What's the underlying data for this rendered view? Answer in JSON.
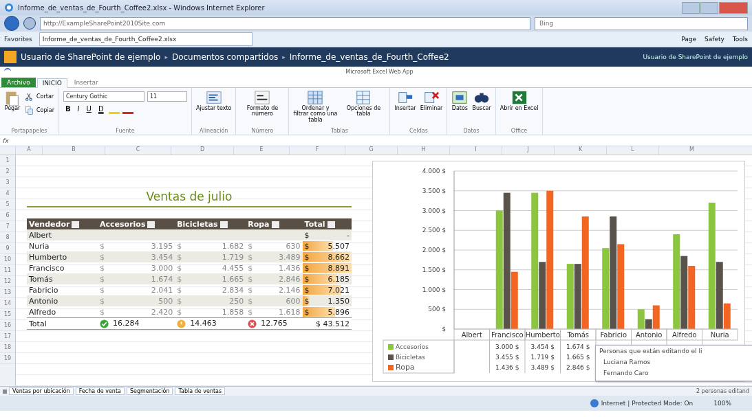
{
  "browser": {
    "title": "Informe_de_ventas_de_Fourth_Coffee2.xlsx - Windows Internet Explorer",
    "address": "http://ExampleSharePoint2010Site.com",
    "search_placeholder": "Bing",
    "favorites": "Favorites",
    "tab": "Informe_de_ventas_de_Fourth_Coffee2.xlsx",
    "commands": [
      "Page",
      "Safety",
      "Tools"
    ]
  },
  "sharepoint": {
    "separator": "▸",
    "breadcrumb": [
      "Usuario de SharePoint de ejemplo",
      "Documentos compartidos",
      "Informe_de_ventas_de_Fourth_Coffee2"
    ],
    "user": "Usuario de SharePoint de ejemplo"
  },
  "app_title": "Microsoft Excel Web App",
  "formula_label": "fx",
  "tabs": [
    {
      "label": "Archivo",
      "kind": "file",
      "selected": false
    },
    {
      "label": "INICIO",
      "kind": "tab",
      "selected": true
    },
    {
      "label": "Insertar",
      "kind": "tab",
      "selected": false
    }
  ],
  "ribbon": [
    {
      "label": "Portapapeles",
      "items": [
        {
          "kind": "paste",
          "label": "Pegar"
        },
        {
          "kind": "cut",
          "label": "Cortar"
        },
        {
          "kind": "copy",
          "label": "Copiar"
        }
      ]
    },
    {
      "label": "Fuente",
      "font": "Century Gothic",
      "size": "11",
      "format_buttons": [
        "B",
        "I",
        "U",
        "D"
      ]
    },
    {
      "label": "Alineación",
      "items": [
        {
          "kind": "wrap",
          "label": "Ajustar texto"
        }
      ]
    },
    {
      "label": "Número",
      "items": [
        {
          "kind": "number",
          "label": "Formato de número"
        }
      ]
    },
    {
      "label": "Tablas",
      "items": [
        {
          "kind": "table",
          "label": "Ordenar y filtrar como una tabla"
        },
        {
          "kind": "options",
          "label": "Opciones de tabla"
        }
      ]
    },
    {
      "label": "Celdas",
      "items": [
        {
          "kind": "insert",
          "label": "Insertar"
        },
        {
          "kind": "delete",
          "label": "Eliminar"
        }
      ]
    },
    {
      "label": "Datos",
      "items": [
        {
          "kind": "data",
          "label": "Datos"
        },
        {
          "kind": "find",
          "label": "Buscar"
        }
      ]
    },
    {
      "label": "Office",
      "items": [
        {
          "kind": "excel",
          "label": "Abrir en Excel"
        }
      ]
    }
  ],
  "columns": [
    "A",
    "B",
    "C",
    "D",
    "E",
    "F",
    "G",
    "H",
    "I",
    "J",
    "K",
    "L",
    "M"
  ],
  "row_numbers": [
    "1",
    "2",
    "3",
    "4",
    "5",
    "6",
    "7",
    "8",
    "9",
    "10",
    "11",
    "12",
    "13",
    "14",
    "15",
    "16",
    "17",
    "18",
    "19"
  ],
  "sheet_title": "Ventas de julio",
  "table": {
    "headers": [
      "Vendedor",
      "Accesorios",
      "Bicicletas",
      "Ropa",
      "Total"
    ],
    "rows": [
      {
        "name": "Albert",
        "cells": [],
        "total_cur": "$",
        "total": "-"
      },
      {
        "name": "Nuria",
        "cells": [
          {
            "cur": "$",
            "val": "3.195"
          },
          {
            "cur": "$",
            "val": "1.682"
          },
          {
            "cur": "$",
            "val": "630"
          }
        ],
        "total_cur": "$",
        "total": "5.507",
        "level": 0.62
      },
      {
        "name": "Humberto",
        "cells": [
          {
            "cur": "$",
            "val": "3.454"
          },
          {
            "cur": "$",
            "val": "1.719"
          },
          {
            "cur": "$",
            "val": "3.489"
          }
        ],
        "total_cur": "$",
        "total": "8.662",
        "level": 0.97
      },
      {
        "name": "Francisco",
        "cells": [
          {
            "cur": "$",
            "val": "3.000"
          },
          {
            "cur": "$",
            "val": "4.455"
          },
          {
            "cur": "$",
            "val": "1.436"
          }
        ],
        "total_cur": "$",
        "total": "8.891",
        "level": 1
      },
      {
        "name": "Tomás",
        "cells": [
          {
            "cur": "$",
            "val": "1.674"
          },
          {
            "cur": "$",
            "val": "1.665"
          },
          {
            "cur": "$",
            "val": "2.846"
          }
        ],
        "total_cur": "$",
        "total": "6.185",
        "level": 0.7
      },
      {
        "name": "Fabricio",
        "cells": [
          {
            "cur": "$",
            "val": "2.041"
          },
          {
            "cur": "$",
            "val": "2.834"
          },
          {
            "cur": "$",
            "val": "2.146"
          }
        ],
        "total_cur": "$",
        "total": "7.021",
        "level": 0.79
      },
      {
        "name": "Antonio",
        "cells": [
          {
            "cur": "$",
            "val": "500"
          },
          {
            "cur": "$",
            "val": "250"
          },
          {
            "cur": "$",
            "val": "600"
          }
        ],
        "total_cur": "$",
        "total": "1.350",
        "level": 0.15
      },
      {
        "name": "Alfredo",
        "cells": [
          {
            "cur": "$",
            "val": "2.420"
          },
          {
            "cur": "$",
            "val": "1.858"
          },
          {
            "cur": "$",
            "val": "1.618"
          }
        ],
        "total_cur": "$",
        "total": "5.896",
        "level": 0.66
      }
    ],
    "total_row": {
      "label": "Total",
      "cells": [
        {
          "kind": "good",
          "val": "16.284"
        },
        {
          "kind": "warn",
          "val": "14.463"
        },
        {
          "kind": "bad",
          "val": "12.765"
        }
      ],
      "total": "$ 43.512"
    }
  },
  "chart": {
    "chart_data": {
      "type": "bar",
      "categories": [
        "Albert",
        "Francisco",
        "Humberto",
        "Tomás",
        "Fabricio",
        "Antonio",
        "Alfredo",
        "Nuria"
      ],
      "ylim": [
        0,
        4000
      ],
      "yticks": [
        {
          "value": 0,
          "label": "$"
        },
        {
          "value": 500,
          "label": "500 $"
        },
        {
          "value": 1000,
          "label": "1.000 $"
        },
        {
          "value": 1500,
          "label": "1.500 $"
        },
        {
          "value": 2000,
          "label": "2.000 $"
        },
        {
          "value": 2500,
          "label": "2.500 $"
        },
        {
          "value": 3000,
          "label": "3.000 $"
        },
        {
          "value": 3500,
          "label": "3.500 $"
        },
        {
          "value": 4000,
          "label": "4.000 $"
        }
      ],
      "grid": true,
      "legend": "left",
      "series": [
        {
          "name": "Accesorios",
          "color": "#8cc63e",
          "values": [
            null,
            3000,
            3450,
            1650,
            2050,
            500,
            2400,
            3200
          ]
        },
        {
          "name": "Bicicletas",
          "color": "#5a534b",
          "values": [
            null,
            3450,
            1700,
            1650,
            2850,
            250,
            1850,
            1700
          ]
        },
        {
          "name": "Ropa",
          "color": "#f26522",
          "values": [
            null,
            1450,
            3500,
            2850,
            2150,
            600,
            1600,
            650
          ]
        }
      ]
    },
    "table_cells": [
      [
        "3.000 $",
        "3.454 $",
        "1.674 $"
      ],
      [
        "3.455 $",
        "1.719 $",
        "1.665 $"
      ],
      [
        "1.436 $",
        "3.489 $",
        "2.846 $"
      ]
    ]
  },
  "editors_popup": {
    "title": "Personas que están editando el li",
    "people": [
      "Luciana Ramos",
      "Fernando Caro"
    ]
  },
  "sheet_tabs": [
    "Ventas por ubicación",
    "Fecha de venta",
    "Segmentación",
    "Tabla de ventas"
  ],
  "editing_status": "2 personas editand",
  "status_bar": {
    "zone": "Internet | Protected Mode: On",
    "zoom": "100%"
  }
}
